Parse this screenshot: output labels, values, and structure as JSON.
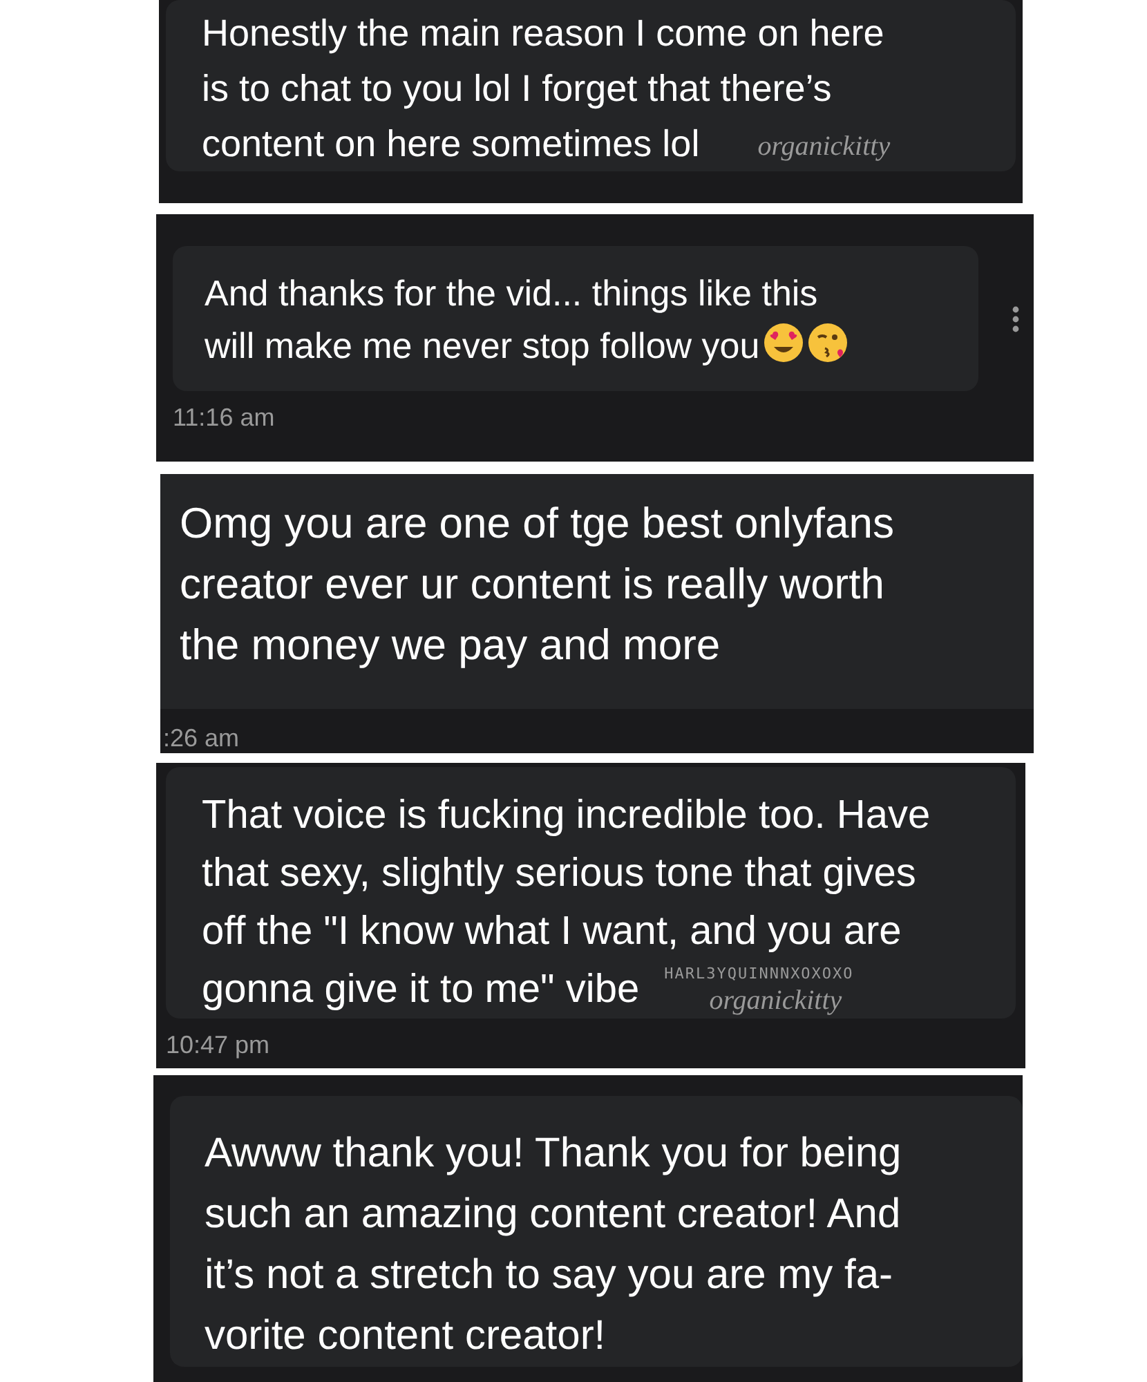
{
  "messages": [
    {
      "kind": "bubble",
      "text": "Honestly the main reason I come on here is to chat to you lol I forget that there’s content on here sometimes lol",
      "signatures": [
        {
          "kind": "script",
          "text": "organickitty"
        }
      ]
    },
    {
      "kind": "bubble",
      "text": "And thanks for the vid... things like this will make me never stop follow you",
      "emoji": true,
      "time": "11:16 am",
      "menu": true
    },
    {
      "kind": "flat",
      "text": "Omg you are one of tge best onlyfans creator ever ur content is really worth the money we pay and more",
      "time": ":26 am"
    },
    {
      "kind": "bubble",
      "text": "That voice is fucking incredible too. Have that sexy, slightly serious tone that gives off the \"I know what I want, and you are gonna give it to me\" vibe",
      "signatures": [
        {
          "kind": "caps",
          "text": "HARL3YQUINNNXOXOXO"
        },
        {
          "kind": "script",
          "text": "organickitty"
        }
      ],
      "time": "10:47 pm"
    },
    {
      "kind": "bubble",
      "text": "Awww thank you! Thank you for being such an amazing content creator! And it’s not a stretch to say you are my fa- vorite content creator!"
    }
  ]
}
